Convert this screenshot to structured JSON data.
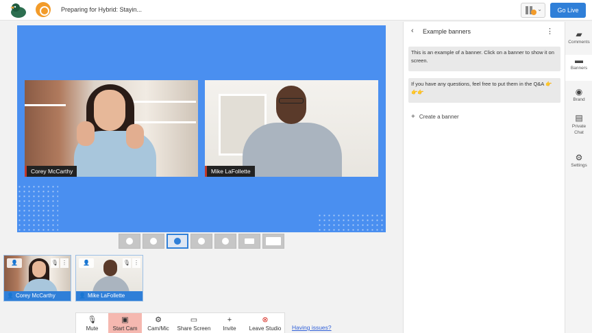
{
  "topbar": {
    "broadcast_title": "Preparing for Hybrid: Stayin...",
    "go_live_label": "Go Live",
    "switcher_chevron": "⌄"
  },
  "stage": {
    "tiles": [
      {
        "name": "Corey McCarthy"
      },
      {
        "name": "Mike LaFollette"
      }
    ]
  },
  "layouts": {
    "count": 7,
    "active_index": 2
  },
  "backstage": [
    {
      "name": "Corey McCarthy"
    },
    {
      "name": "Mike LaFollette"
    }
  ],
  "controls": {
    "items": [
      {
        "label": "Mute",
        "icon": "microphone-icon",
        "glyph": "🎙"
      },
      {
        "label": "Start Cam",
        "icon": "camera-off-icon",
        "glyph": "▣"
      },
      {
        "label": "Cam/Mic",
        "icon": "gear-icon",
        "glyph": "⚙"
      },
      {
        "label": "Share Screen",
        "icon": "monitor-icon",
        "glyph": "▭"
      },
      {
        "label": "Invite",
        "icon": "add-person-icon",
        "glyph": "+"
      },
      {
        "label": "Leave Studio",
        "icon": "close-circle-icon",
        "glyph": "⊗"
      }
    ],
    "help_link": "Having issues?"
  },
  "panel": {
    "title": "Example banners",
    "banners": [
      "This is an example of a banner. Click on a banner to show it on screen.",
      "If you have any questions, feel free to put them in the Q&A 👉👉👉"
    ],
    "create_label": "Create a banner"
  },
  "rail": {
    "items": [
      {
        "label": "Comments",
        "icon": "comment-icon"
      },
      {
        "label": "Banners",
        "icon": "banner-icon"
      },
      {
        "label": "Brand",
        "icon": "palette-icon"
      },
      {
        "label": "Private Chat",
        "icon": "chat-icon"
      },
      {
        "label": "Settings",
        "icon": "gear-icon"
      }
    ]
  },
  "colors": {
    "accent": "#2f7fd8",
    "stage_bg": "#4a8ff0",
    "active_cam": "#f5b8b0"
  }
}
